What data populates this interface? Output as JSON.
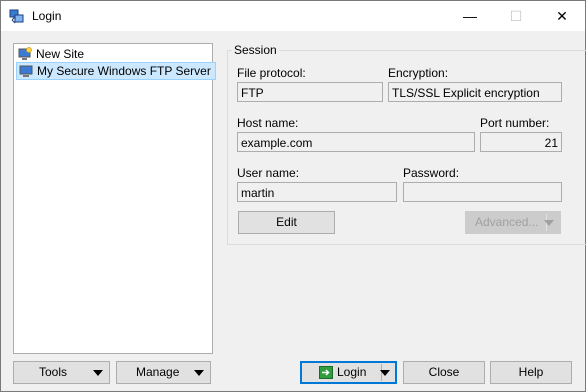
{
  "window": {
    "title": "Login",
    "controls": {
      "minimize": "—",
      "maximize": "☐",
      "close": "✕"
    }
  },
  "sites": [
    {
      "label": "New Site",
      "icon": "new-site-icon",
      "selected": false
    },
    {
      "label": "My Secure Windows FTP Server",
      "icon": "computer-icon",
      "selected": true
    }
  ],
  "session": {
    "group_title": "Session",
    "file_protocol_label": "File protocol:",
    "file_protocol_value": "FTP",
    "encryption_label": "Encryption:",
    "encryption_value": "TLS/SSL Explicit encryption",
    "host_label": "Host name:",
    "host_value": "example.com",
    "port_label": "Port number:",
    "port_value": "21",
    "user_label": "User name:",
    "user_value": "martin",
    "password_label": "Password:",
    "password_value": "",
    "edit_label": "Edit",
    "advanced_label": "Advanced..."
  },
  "buttons": {
    "tools": "Tools",
    "manage": "Manage",
    "login": "Login",
    "close": "Close",
    "help": "Help"
  },
  "colors": {
    "selection": "#cce8ff",
    "accent": "#0078d7",
    "login_icon": "#2e9e3e"
  }
}
